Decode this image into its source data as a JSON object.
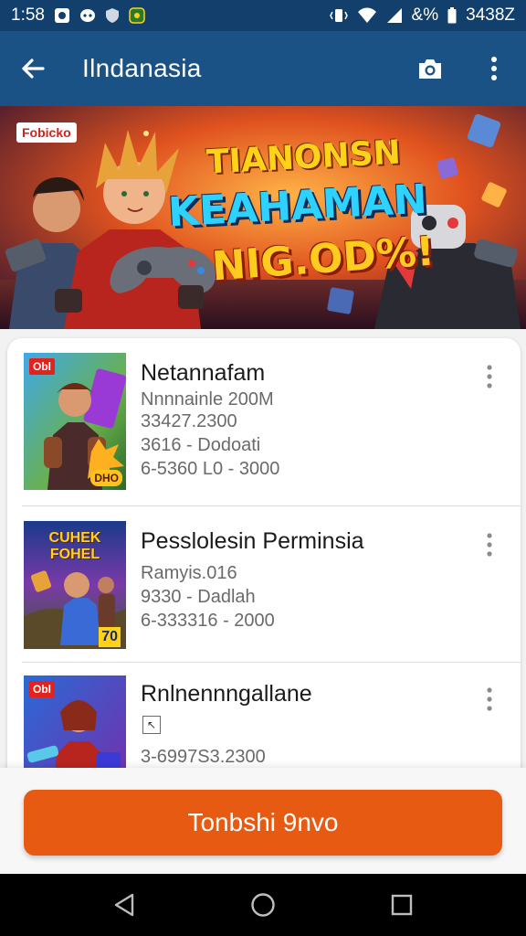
{
  "status_bar": {
    "time": "1:58",
    "battery_text": "&% ",
    "extra_text": "3438Z",
    "icons": [
      "notification-icon",
      "chat-icon",
      "shield-icon",
      "app-icon",
      "vibrate-icon",
      "wifi-icon",
      "signal-icon",
      "battery-icon"
    ]
  },
  "app_bar": {
    "title": "Ilndanasia",
    "back_icon": "arrow-left-icon",
    "camera_icon": "camera-icon",
    "menu_icon": "more-vertical-icon"
  },
  "banner": {
    "badge": "Fobicko",
    "line1": "TIANONSN",
    "line2": "KEAHAMAN",
    "line3": "NIG.OD%!"
  },
  "list": {
    "items": [
      {
        "thumb_badge": "Obl",
        "thumb_corner": "DHO",
        "title": "Netannafam",
        "line1": "Nnnnainle 200M",
        "line2": "33427.2300",
        "line3": "3616 - Dodoati",
        "line4": "6-5360 L0 - 3000"
      },
      {
        "thumb_title": "CUHEK FOHEL",
        "thumb_num": "70",
        "title": "Pesslolesin Perminsia",
        "line1": "Ramyis.016",
        "line2": "9330 - Dadlah",
        "line3": "6-333316 - 2000"
      },
      {
        "thumb_badge": "Obl",
        "title": "Rnlnennngallane",
        "line1": "3-6997S3.2300"
      }
    ]
  },
  "cta": {
    "label": "Tonbshi 9nvo"
  },
  "nav_bar": {
    "back_icon": "nav-back-icon",
    "home_icon": "nav-home-icon",
    "recents_icon": "nav-recents-icon"
  }
}
